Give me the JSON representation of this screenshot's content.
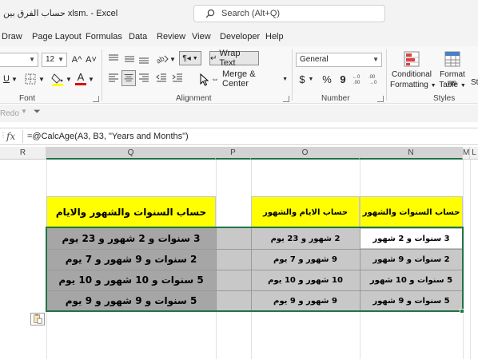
{
  "window": {
    "title": "حساب الفرق بين xlsm.  -  Excel",
    "search_placeholder": "Search (Alt+Q)"
  },
  "menu_tabs": [
    "Draw",
    "Page Layout",
    "Formulas",
    "Data",
    "Review",
    "View",
    "Developer",
    "Help"
  ],
  "ribbon": {
    "font_group": {
      "label": "Font",
      "font_size": "12",
      "grow_font": "A^",
      "shrink_font": "A˅",
      "underline": "U",
      "font_color_letter": "A"
    },
    "alignment_group": {
      "label": "Alignment",
      "wrap_text": "Wrap Text",
      "merge_center": "Merge & Center"
    },
    "number_group": {
      "label": "Number",
      "format": "General",
      "currency": "$",
      "percent": "%",
      "comma": "9"
    },
    "styles_group": {
      "label": "Styles",
      "conditional_formatting_line1": "Conditional",
      "conditional_formatting_line2": "Formatting",
      "format_as_table_line1": "Format as",
      "format_as_table_line2": "Table",
      "cell_styles": "Sty"
    }
  },
  "quick_access": {
    "redo": "Redo"
  },
  "formula_bar": {
    "fx_label": "fx",
    "formula": "=@CalcAge(A3, B3, \"Years and Months\")"
  },
  "columns": [
    "R",
    "Q",
    "P",
    "O",
    "N",
    "M",
    "L"
  ],
  "sheet": {
    "headers": {
      "q": "حساب  السنوات والشهور والايام",
      "o": "حساب الايام والشهور",
      "n": "حساب  السنوات والشهور"
    },
    "rows": [
      {
        "q": "3 سنوات و 2 شهور و 23 يوم",
        "o": "2 شهور و 23 يوم",
        "n": "3 سنوات و 2 شهور"
      },
      {
        "q": "2 سنوات و 9 شهور و 7 يوم",
        "o": "9 شهور و 7 يوم",
        "n": "2 سنوات و 9 شهور"
      },
      {
        "q": "5 سنوات و 10 شهور و 10 يوم",
        "o": "10 شهور و 10 يوم",
        "n": "5 سنوات و 10 شهور"
      },
      {
        "q": "5 سنوات و 9 شهور و 9 يوم",
        "o": "9 شهور و 9 يوم",
        "n": "5 سنوات و 9 شهور"
      }
    ]
  },
  "colors": {
    "header_fill": "#ffff00",
    "selection_border": "#217346",
    "q_fill": "#a6a6a6",
    "selected_fill": "#c8c8c8"
  }
}
